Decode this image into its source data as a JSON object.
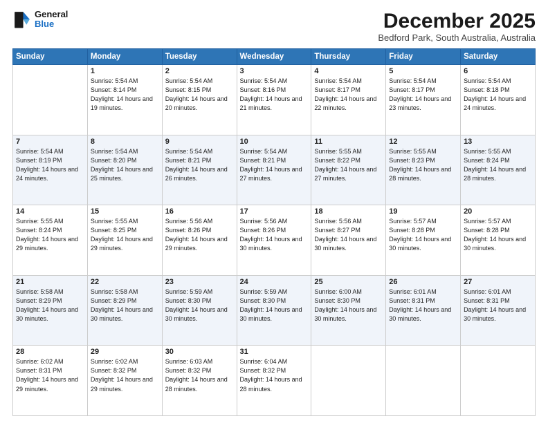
{
  "logo": {
    "line1": "General",
    "line2": "Blue"
  },
  "header": {
    "title": "December 2025",
    "subtitle": "Bedford Park, South Australia, Australia"
  },
  "weekdays": [
    "Sunday",
    "Monday",
    "Tuesday",
    "Wednesday",
    "Thursday",
    "Friday",
    "Saturday"
  ],
  "weeks": [
    [
      {
        "day": "",
        "info": ""
      },
      {
        "day": "1",
        "info": "Sunrise: 5:54 AM\nSunset: 8:14 PM\nDaylight: 14 hours\nand 19 minutes."
      },
      {
        "day": "2",
        "info": "Sunrise: 5:54 AM\nSunset: 8:15 PM\nDaylight: 14 hours\nand 20 minutes."
      },
      {
        "day": "3",
        "info": "Sunrise: 5:54 AM\nSunset: 8:16 PM\nDaylight: 14 hours\nand 21 minutes."
      },
      {
        "day": "4",
        "info": "Sunrise: 5:54 AM\nSunset: 8:17 PM\nDaylight: 14 hours\nand 22 minutes."
      },
      {
        "day": "5",
        "info": "Sunrise: 5:54 AM\nSunset: 8:17 PM\nDaylight: 14 hours\nand 23 minutes."
      },
      {
        "day": "6",
        "info": "Sunrise: 5:54 AM\nSunset: 8:18 PM\nDaylight: 14 hours\nand 24 minutes."
      }
    ],
    [
      {
        "day": "7",
        "info": "Sunrise: 5:54 AM\nSunset: 8:19 PM\nDaylight: 14 hours\nand 24 minutes."
      },
      {
        "day": "8",
        "info": "Sunrise: 5:54 AM\nSunset: 8:20 PM\nDaylight: 14 hours\nand 25 minutes."
      },
      {
        "day": "9",
        "info": "Sunrise: 5:54 AM\nSunset: 8:21 PM\nDaylight: 14 hours\nand 26 minutes."
      },
      {
        "day": "10",
        "info": "Sunrise: 5:54 AM\nSunset: 8:21 PM\nDaylight: 14 hours\nand 27 minutes."
      },
      {
        "day": "11",
        "info": "Sunrise: 5:55 AM\nSunset: 8:22 PM\nDaylight: 14 hours\nand 27 minutes."
      },
      {
        "day": "12",
        "info": "Sunrise: 5:55 AM\nSunset: 8:23 PM\nDaylight: 14 hours\nand 28 minutes."
      },
      {
        "day": "13",
        "info": "Sunrise: 5:55 AM\nSunset: 8:24 PM\nDaylight: 14 hours\nand 28 minutes."
      }
    ],
    [
      {
        "day": "14",
        "info": "Sunrise: 5:55 AM\nSunset: 8:24 PM\nDaylight: 14 hours\nand 29 minutes."
      },
      {
        "day": "15",
        "info": "Sunrise: 5:55 AM\nSunset: 8:25 PM\nDaylight: 14 hours\nand 29 minutes."
      },
      {
        "day": "16",
        "info": "Sunrise: 5:56 AM\nSunset: 8:26 PM\nDaylight: 14 hours\nand 29 minutes."
      },
      {
        "day": "17",
        "info": "Sunrise: 5:56 AM\nSunset: 8:26 PM\nDaylight: 14 hours\nand 30 minutes."
      },
      {
        "day": "18",
        "info": "Sunrise: 5:56 AM\nSunset: 8:27 PM\nDaylight: 14 hours\nand 30 minutes."
      },
      {
        "day": "19",
        "info": "Sunrise: 5:57 AM\nSunset: 8:28 PM\nDaylight: 14 hours\nand 30 minutes."
      },
      {
        "day": "20",
        "info": "Sunrise: 5:57 AM\nSunset: 8:28 PM\nDaylight: 14 hours\nand 30 minutes."
      }
    ],
    [
      {
        "day": "21",
        "info": "Sunrise: 5:58 AM\nSunset: 8:29 PM\nDaylight: 14 hours\nand 30 minutes."
      },
      {
        "day": "22",
        "info": "Sunrise: 5:58 AM\nSunset: 8:29 PM\nDaylight: 14 hours\nand 30 minutes."
      },
      {
        "day": "23",
        "info": "Sunrise: 5:59 AM\nSunset: 8:30 PM\nDaylight: 14 hours\nand 30 minutes."
      },
      {
        "day": "24",
        "info": "Sunrise: 5:59 AM\nSunset: 8:30 PM\nDaylight: 14 hours\nand 30 minutes."
      },
      {
        "day": "25",
        "info": "Sunrise: 6:00 AM\nSunset: 8:30 PM\nDaylight: 14 hours\nand 30 minutes."
      },
      {
        "day": "26",
        "info": "Sunrise: 6:01 AM\nSunset: 8:31 PM\nDaylight: 14 hours\nand 30 minutes."
      },
      {
        "day": "27",
        "info": "Sunrise: 6:01 AM\nSunset: 8:31 PM\nDaylight: 14 hours\nand 30 minutes."
      }
    ],
    [
      {
        "day": "28",
        "info": "Sunrise: 6:02 AM\nSunset: 8:31 PM\nDaylight: 14 hours\nand 29 minutes."
      },
      {
        "day": "29",
        "info": "Sunrise: 6:02 AM\nSunset: 8:32 PM\nDaylight: 14 hours\nand 29 minutes."
      },
      {
        "day": "30",
        "info": "Sunrise: 6:03 AM\nSunset: 8:32 PM\nDaylight: 14 hours\nand 28 minutes."
      },
      {
        "day": "31",
        "info": "Sunrise: 6:04 AM\nSunset: 8:32 PM\nDaylight: 14 hours\nand 28 minutes."
      },
      {
        "day": "",
        "info": ""
      },
      {
        "day": "",
        "info": ""
      },
      {
        "day": "",
        "info": ""
      }
    ]
  ]
}
